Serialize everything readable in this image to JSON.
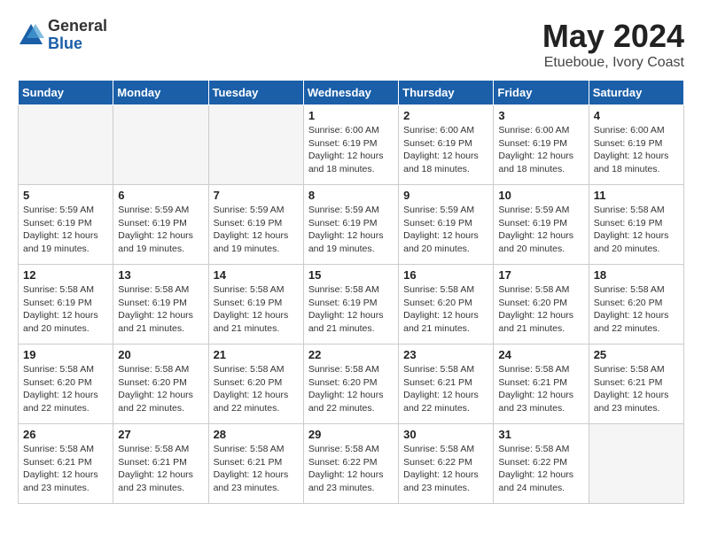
{
  "logo": {
    "general": "General",
    "blue": "Blue"
  },
  "title": "May 2024",
  "subtitle": "Etueboue, Ivory Coast",
  "weekdays": [
    "Sunday",
    "Monday",
    "Tuesday",
    "Wednesday",
    "Thursday",
    "Friday",
    "Saturday"
  ],
  "weeks": [
    [
      {
        "day": "",
        "info": ""
      },
      {
        "day": "",
        "info": ""
      },
      {
        "day": "",
        "info": ""
      },
      {
        "day": "1",
        "info": "Sunrise: 6:00 AM\nSunset: 6:19 PM\nDaylight: 12 hours\nand 18 minutes."
      },
      {
        "day": "2",
        "info": "Sunrise: 6:00 AM\nSunset: 6:19 PM\nDaylight: 12 hours\nand 18 minutes."
      },
      {
        "day": "3",
        "info": "Sunrise: 6:00 AM\nSunset: 6:19 PM\nDaylight: 12 hours\nand 18 minutes."
      },
      {
        "day": "4",
        "info": "Sunrise: 6:00 AM\nSunset: 6:19 PM\nDaylight: 12 hours\nand 18 minutes."
      }
    ],
    [
      {
        "day": "5",
        "info": "Sunrise: 5:59 AM\nSunset: 6:19 PM\nDaylight: 12 hours\nand 19 minutes."
      },
      {
        "day": "6",
        "info": "Sunrise: 5:59 AM\nSunset: 6:19 PM\nDaylight: 12 hours\nand 19 minutes."
      },
      {
        "day": "7",
        "info": "Sunrise: 5:59 AM\nSunset: 6:19 PM\nDaylight: 12 hours\nand 19 minutes."
      },
      {
        "day": "8",
        "info": "Sunrise: 5:59 AM\nSunset: 6:19 PM\nDaylight: 12 hours\nand 19 minutes."
      },
      {
        "day": "9",
        "info": "Sunrise: 5:59 AM\nSunset: 6:19 PM\nDaylight: 12 hours\nand 20 minutes."
      },
      {
        "day": "10",
        "info": "Sunrise: 5:59 AM\nSunset: 6:19 PM\nDaylight: 12 hours\nand 20 minutes."
      },
      {
        "day": "11",
        "info": "Sunrise: 5:58 AM\nSunset: 6:19 PM\nDaylight: 12 hours\nand 20 minutes."
      }
    ],
    [
      {
        "day": "12",
        "info": "Sunrise: 5:58 AM\nSunset: 6:19 PM\nDaylight: 12 hours\nand 20 minutes."
      },
      {
        "day": "13",
        "info": "Sunrise: 5:58 AM\nSunset: 6:19 PM\nDaylight: 12 hours\nand 21 minutes."
      },
      {
        "day": "14",
        "info": "Sunrise: 5:58 AM\nSunset: 6:19 PM\nDaylight: 12 hours\nand 21 minutes."
      },
      {
        "day": "15",
        "info": "Sunrise: 5:58 AM\nSunset: 6:19 PM\nDaylight: 12 hours\nand 21 minutes."
      },
      {
        "day": "16",
        "info": "Sunrise: 5:58 AM\nSunset: 6:20 PM\nDaylight: 12 hours\nand 21 minutes."
      },
      {
        "day": "17",
        "info": "Sunrise: 5:58 AM\nSunset: 6:20 PM\nDaylight: 12 hours\nand 21 minutes."
      },
      {
        "day": "18",
        "info": "Sunrise: 5:58 AM\nSunset: 6:20 PM\nDaylight: 12 hours\nand 22 minutes."
      }
    ],
    [
      {
        "day": "19",
        "info": "Sunrise: 5:58 AM\nSunset: 6:20 PM\nDaylight: 12 hours\nand 22 minutes."
      },
      {
        "day": "20",
        "info": "Sunrise: 5:58 AM\nSunset: 6:20 PM\nDaylight: 12 hours\nand 22 minutes."
      },
      {
        "day": "21",
        "info": "Sunrise: 5:58 AM\nSunset: 6:20 PM\nDaylight: 12 hours\nand 22 minutes."
      },
      {
        "day": "22",
        "info": "Sunrise: 5:58 AM\nSunset: 6:20 PM\nDaylight: 12 hours\nand 22 minutes."
      },
      {
        "day": "23",
        "info": "Sunrise: 5:58 AM\nSunset: 6:21 PM\nDaylight: 12 hours\nand 22 minutes."
      },
      {
        "day": "24",
        "info": "Sunrise: 5:58 AM\nSunset: 6:21 PM\nDaylight: 12 hours\nand 23 minutes."
      },
      {
        "day": "25",
        "info": "Sunrise: 5:58 AM\nSunset: 6:21 PM\nDaylight: 12 hours\nand 23 minutes."
      }
    ],
    [
      {
        "day": "26",
        "info": "Sunrise: 5:58 AM\nSunset: 6:21 PM\nDaylight: 12 hours\nand 23 minutes."
      },
      {
        "day": "27",
        "info": "Sunrise: 5:58 AM\nSunset: 6:21 PM\nDaylight: 12 hours\nand 23 minutes."
      },
      {
        "day": "28",
        "info": "Sunrise: 5:58 AM\nSunset: 6:21 PM\nDaylight: 12 hours\nand 23 minutes."
      },
      {
        "day": "29",
        "info": "Sunrise: 5:58 AM\nSunset: 6:22 PM\nDaylight: 12 hours\nand 23 minutes."
      },
      {
        "day": "30",
        "info": "Sunrise: 5:58 AM\nSunset: 6:22 PM\nDaylight: 12 hours\nand 23 minutes."
      },
      {
        "day": "31",
        "info": "Sunrise: 5:58 AM\nSunset: 6:22 PM\nDaylight: 12 hours\nand 24 minutes."
      },
      {
        "day": "",
        "info": ""
      }
    ]
  ]
}
